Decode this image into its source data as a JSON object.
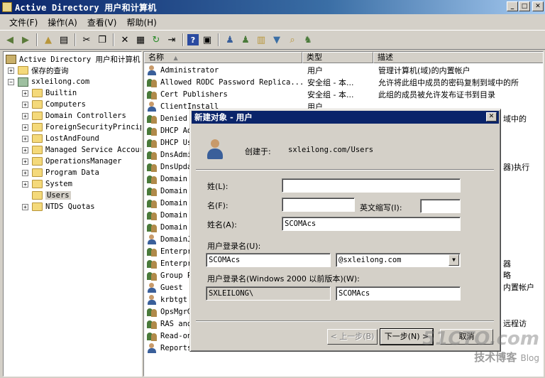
{
  "window": {
    "title": "Active Directory 用户和计算机"
  },
  "menu": [
    "文件(F)",
    "操作(A)",
    "查看(V)",
    "帮助(H)"
  ],
  "tree": {
    "root": "Active Directory 用户和计算机",
    "saved": "保存的查询",
    "domain": "sxleilong.com",
    "children": [
      "Builtin",
      "Computers",
      "Domain Controllers",
      "ForeignSecurityPrincip",
      "LostAndFound",
      "Managed Service Accour",
      "OperationsManager",
      "Program Data",
      "System",
      "Users",
      "NTDS Quotas"
    ],
    "selected": "Users"
  },
  "list": {
    "headers": {
      "name": "名称",
      "type": "类型",
      "desc": "描述"
    },
    "rows": [
      {
        "name": "Administrator",
        "type": "用户",
        "desc": "管理计算机(域)的内置帐户",
        "icon": "user"
      },
      {
        "name": "Allowed RODC Password Replica...",
        "type": "安全组 - 本...",
        "desc": "允许将此组中成员的密码复制到域中的所",
        "icon": "group"
      },
      {
        "name": "Cert Publishers",
        "type": "安全组 - 本...",
        "desc": "此组的成员被允许发布证书到目录",
        "icon": "group"
      },
      {
        "name": "ClientInstall",
        "type": "用户",
        "desc": "",
        "icon": "user"
      },
      {
        "name": "Denied",
        "icon": "group"
      },
      {
        "name": "DHCP Ad",
        "icon": "group"
      },
      {
        "name": "DHCP Us",
        "icon": "group"
      },
      {
        "name": "DnsAdmi",
        "icon": "group"
      },
      {
        "name": "DnsUpda",
        "icon": "group"
      },
      {
        "name": "Domain",
        "icon": "group"
      },
      {
        "name": "Domain",
        "icon": "group"
      },
      {
        "name": "Domain",
        "icon": "group"
      },
      {
        "name": "Domain",
        "icon": "group"
      },
      {
        "name": "Domain",
        "icon": "group"
      },
      {
        "name": "DomainJ",
        "icon": "user"
      },
      {
        "name": "Enterpr",
        "icon": "group"
      },
      {
        "name": "Enterpr",
        "icon": "group"
      },
      {
        "name": "Group P",
        "icon": "group"
      },
      {
        "name": "Guest",
        "icon": "user"
      },
      {
        "name": "krbtgt",
        "icon": "user"
      },
      {
        "name": "OpsMgrG",
        "icon": "group"
      },
      {
        "name": "RAS and",
        "icon": "group"
      },
      {
        "name": "Read-on",
        "icon": "group"
      },
      {
        "name": "Reports",
        "icon": "user"
      }
    ],
    "peeks": [
      "域中的",
      "器)执行",
      "器",
      "器",
      "略",
      "内置帐户",
      "远程访"
    ]
  },
  "dialog": {
    "title": "新建对象 - 用户",
    "created_in_label": "创建于:",
    "created_in_value": "sxleilong.com/Users",
    "last_name_label": "姓(L):",
    "last_name_value": "",
    "first_name_label": "名(F):",
    "first_name_value": "",
    "initials_label": "英文缩写(I):",
    "initials_value": "",
    "full_name_label": "姓名(A):",
    "full_name_value": "SCOMAcs",
    "logon_label": "用户登录名(U):",
    "logon_value": "SCOMAcs",
    "upn_suffix": "@sxleilong.com",
    "pre2000_label": "用户登录名(Windows 2000 以前版本)(W):",
    "pre2000_domain": "SXLEILONG\\",
    "pre2000_value": "SCOMAcs",
    "back_button": "< 上一步(B)",
    "next_button": "下一步(N) >",
    "cancel_button": "取消"
  },
  "watermark": {
    "line1": "51CTO.com",
    "line2": "技术博客",
    "line3": "Blog"
  }
}
